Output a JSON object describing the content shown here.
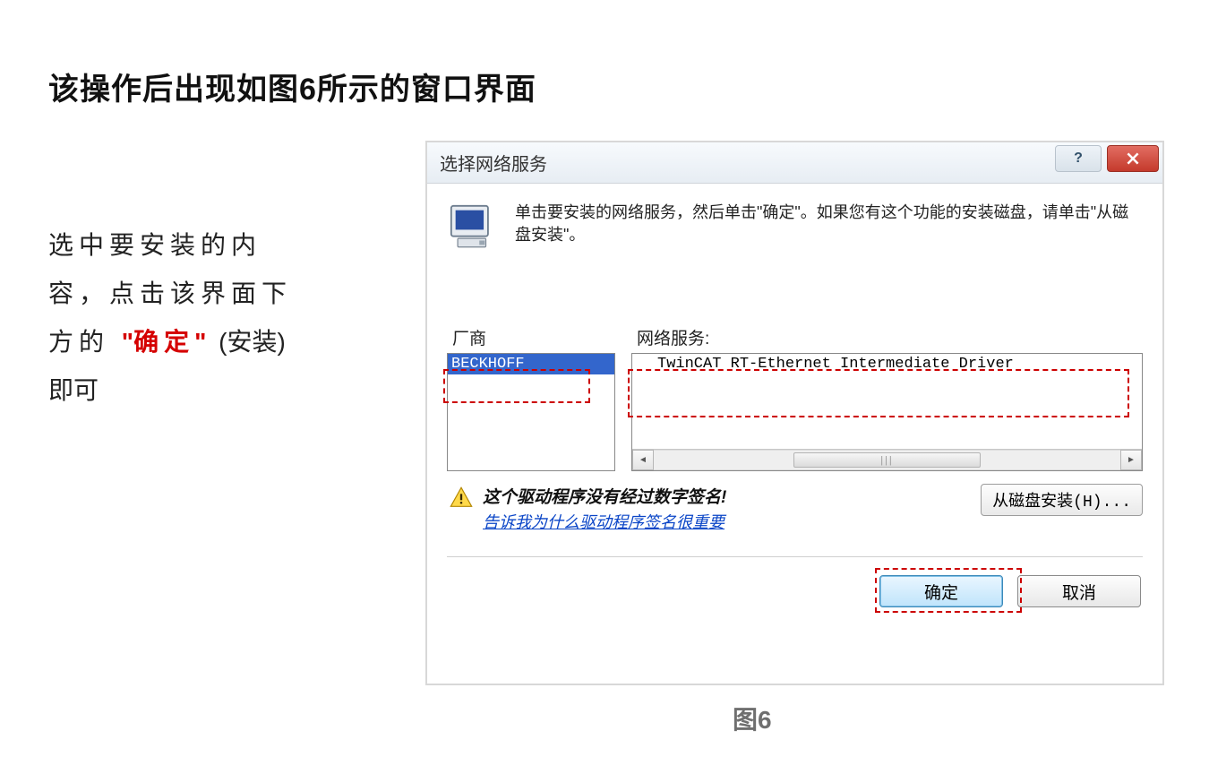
{
  "page": {
    "title": "该操作后出现如图6所示的窗口界面",
    "figure_caption": "图6"
  },
  "side": {
    "part1": "选中要安装的内容，点击该界面下方的",
    "confirm_quote_open": "\"",
    "confirm_word": "确定",
    "confirm_quote_close": "\"",
    "part2": "(安装)即可"
  },
  "dialog": {
    "title": "选择网络服务",
    "help_symbol": "?",
    "instruction": "单击要安装的网络服务，然后单击\"确定\"。如果您有这个功能的安装磁盘，请单击\"从磁盘安装\"。",
    "col_left_label": "厂商",
    "col_right_label": "网络服务:",
    "vendor_item": "BECKHOFF",
    "service_item": "TwinCAT RT-Ethernet Intermediate Driver",
    "warn_bold": "这个驱动程序没有经过数字签名!",
    "warn_link": "告诉我为什么驱动程序签名很重要",
    "disk_button": "从磁盘安装(H)...",
    "ok_button": "确定",
    "cancel_button": "取消"
  }
}
